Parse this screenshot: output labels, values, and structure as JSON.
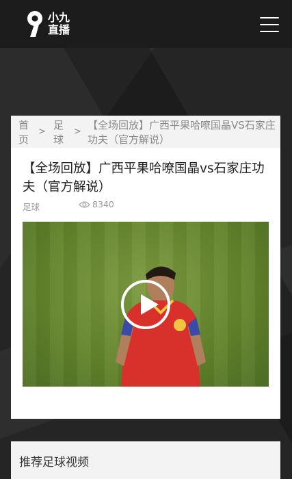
{
  "header": {
    "logo_text_line1": "小九",
    "logo_text_line2": "直播",
    "menu_icon": "hamburger-menu-icon"
  },
  "breadcrumb": {
    "home": "首页",
    "category": "足球",
    "separator": ">",
    "current": "【全场回放】广西平果哈嘹国晶VS石家庄功夫（官方解说）"
  },
  "article": {
    "title": "【全场回放】广西平果哈嘹国晶vs石家庄功夫（官方解说）",
    "category": "足球",
    "views": "8340",
    "view_icon": "eye-icon"
  },
  "video": {
    "play_icon": "play-icon"
  },
  "recommend": {
    "title": "推荐足球视频"
  },
  "colors": {
    "header_bg": "#1c1c1c",
    "page_bg": "#252525",
    "card_bg": "#ffffff",
    "breadcrumb_bg": "#f3f3f3",
    "pitch_green": "#62832c",
    "jersey_red": "#d8302a"
  }
}
